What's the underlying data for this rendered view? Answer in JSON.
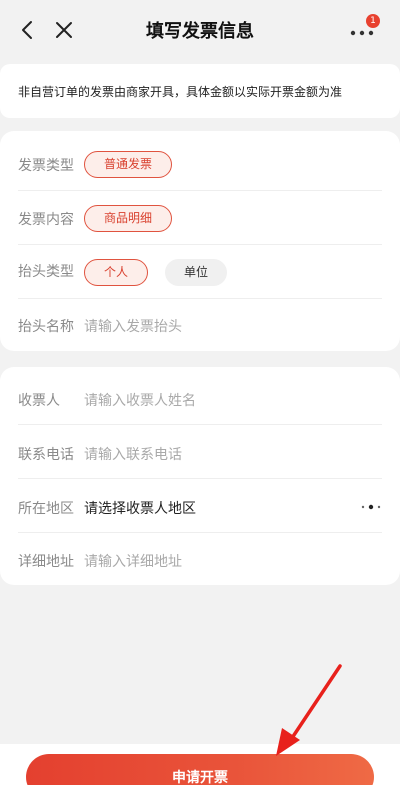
{
  "header": {
    "title": "填写发票信息",
    "badge_count": "1",
    "icons": {
      "back": "chevron-left-icon",
      "close": "close-icon",
      "more": "more-dots-icon"
    }
  },
  "notice": {
    "text": "非自营订单的发票由商家开具，具体金额以实际开票金额为准"
  },
  "invoice": {
    "type_label": "发票类型",
    "type_value": "普通发票",
    "content_label": "发票内容",
    "content_value": "商品明细",
    "title_type_label": "抬头类型",
    "title_type_personal": "个人",
    "title_type_company": "单位",
    "title_name_label": "抬头名称",
    "title_name_placeholder": "请输入发票抬头"
  },
  "recipient": {
    "name_label": "收票人",
    "name_placeholder": "请输入收票人姓名",
    "phone_label": "联系电话",
    "phone_placeholder": "请输入联系电话",
    "region_label": "所在地区",
    "region_value": "请选择收票人地区",
    "address_label": "详细地址",
    "address_placeholder": "请输入详细地址"
  },
  "actions": {
    "submit_label": "申请开票"
  },
  "colors": {
    "accent": "#e4402f",
    "chip_bg": "#fdeeea",
    "background": "#f2f2f2"
  }
}
